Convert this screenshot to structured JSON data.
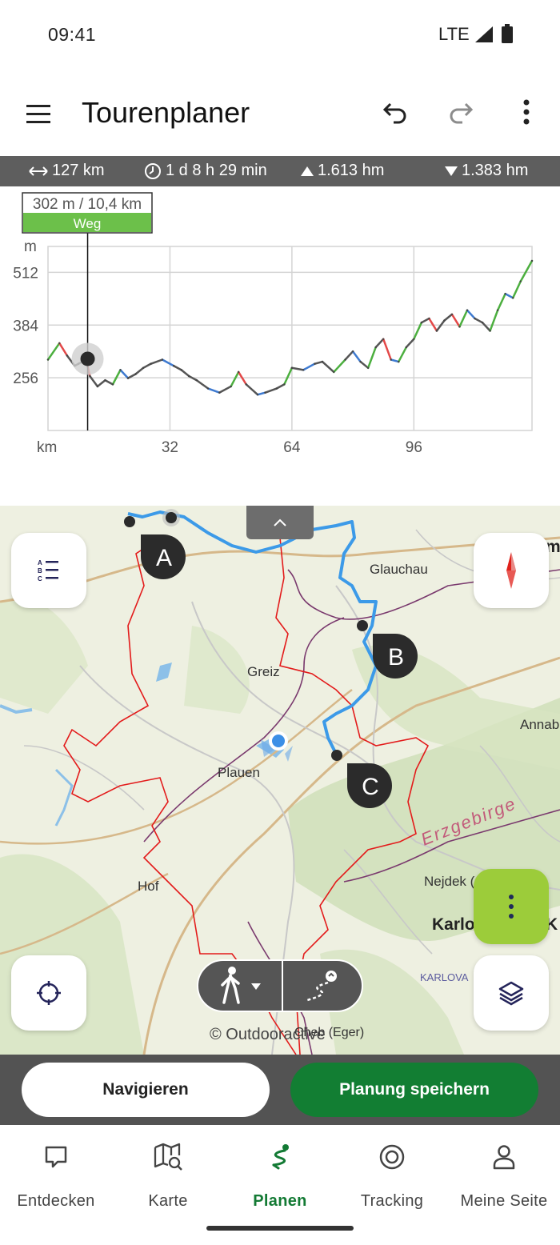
{
  "status_bar": {
    "time": "09:41",
    "network": "LTE"
  },
  "app_bar": {
    "title": "Tourenplaner"
  },
  "stats": {
    "distance": "127 km",
    "duration": "1 d 8 h 29 min",
    "ascent": "1.613 hm",
    "descent": "1.383 hm"
  },
  "profile": {
    "cursor_readout": "302 m / 10,4 km",
    "cursor_surface": "Weg",
    "y_unit": "m",
    "x_unit": "km",
    "chart_data": {
      "type": "line",
      "title": "",
      "xlabel": "km",
      "ylabel": "m",
      "x_ticks": [
        32,
        64,
        96
      ],
      "y_ticks": [
        256,
        384,
        512
      ],
      "xlim": [
        0,
        127
      ],
      "ylim": [
        128,
        575
      ],
      "grid": true,
      "cursor": {
        "x": 10.4,
        "y": 302
      },
      "series": [
        {
          "x": [
            0,
            3,
            5,
            7,
            8,
            10,
            11,
            13,
            15,
            17,
            19,
            21,
            23,
            25,
            27,
            30,
            33,
            35,
            37,
            39,
            42,
            45,
            48,
            50,
            52,
            55,
            57,
            60,
            62,
            64,
            67,
            70,
            72,
            75,
            78,
            80,
            82,
            84,
            86,
            88,
            90,
            92,
            94,
            96,
            98,
            100,
            102,
            104,
            106,
            108,
            110,
            112,
            114,
            116,
            118,
            120,
            122,
            124,
            127
          ],
          "y": [
            300,
            340,
            310,
            285,
            290,
            300,
            260,
            235,
            250,
            240,
            275,
            255,
            265,
            280,
            290,
            300,
            285,
            275,
            260,
            250,
            230,
            220,
            235,
            270,
            240,
            215,
            220,
            230,
            240,
            280,
            275,
            290,
            295,
            270,
            300,
            320,
            295,
            280,
            330,
            350,
            300,
            295,
            330,
            350,
            390,
            400,
            370,
            395,
            410,
            380,
            420,
            400,
            390,
            370,
            420,
            460,
            450,
            490,
            540
          ]
        }
      ]
    }
  },
  "map": {
    "labels": {
      "glauchau": "Glauchau",
      "greiz": "Greiz",
      "plauen": "Plauen",
      "hof": "Hof",
      "annaberg": "Annab",
      "erzgebirge": "Erzgebirge",
      "nejdek": "Nejdek (",
      "karlovy": "Karlo",
      "karlovy_suffix": "K",
      "karlova": "KARLOVA",
      "cheb": "Cheb (Eger)",
      "edge_m": "m"
    },
    "waypoints": {
      "a": "A",
      "b": "B",
      "c": "C"
    },
    "copyright": "© Outdooractive"
  },
  "actions": {
    "navigate": "Navigieren",
    "save": "Planung speichern"
  },
  "bottom_nav": {
    "items": [
      {
        "label": "Entdecken"
      },
      {
        "label": "Karte"
      },
      {
        "label": "Planen"
      },
      {
        "label": "Tracking"
      },
      {
        "label": "Meine Seite"
      }
    ]
  },
  "colors": {
    "accent_green": "#127e33",
    "route_blue": "#3c9ae8",
    "border_red": "#e31b1b",
    "fab_green": "#9ccc3a"
  }
}
